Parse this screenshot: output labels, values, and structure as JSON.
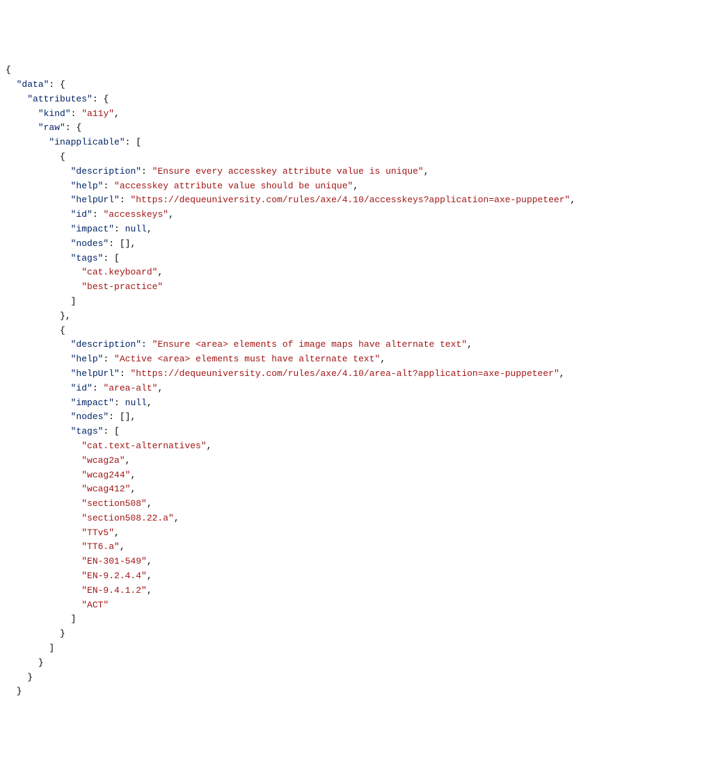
{
  "json_tree": {
    "data": {
      "attributes": {
        "kind": "a11y",
        "raw": {
          "inapplicable": [
            {
              "description": "Ensure every accesskey attribute value is unique",
              "help": "accesskey attribute value should be unique",
              "helpUrl": "https://dequeuniversity.com/rules/axe/4.10/accesskeys?application=axe-puppeteer",
              "id": "accesskeys",
              "impact": null,
              "nodes": [],
              "tags": [
                "cat.keyboard",
                "best-practice"
              ]
            },
            {
              "description": "Ensure <area> elements of image maps have alternate text",
              "help": "Active <area> elements must have alternate text",
              "helpUrl": "https://dequeuniversity.com/rules/axe/4.10/area-alt?application=axe-puppeteer",
              "id": "area-alt",
              "impact": null,
              "nodes": [],
              "tags": [
                "cat.text-alternatives",
                "wcag2a",
                "wcag244",
                "wcag412",
                "section508",
                "section508.22.a",
                "TTv5",
                "TT6.a",
                "EN-301-549",
                "EN-9.2.4.4",
                "EN-9.4.1.2",
                "ACT"
              ]
            }
          ]
        }
      }
    }
  }
}
